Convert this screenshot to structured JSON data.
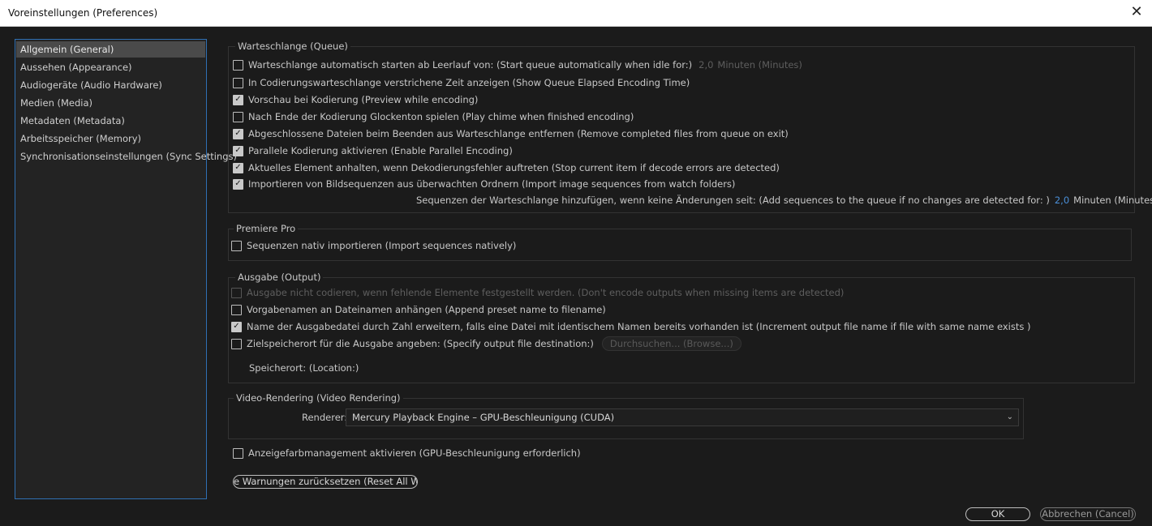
{
  "window": {
    "title": "Voreinstellungen (Preferences)",
    "close_glyph": "✕"
  },
  "sidebar": {
    "items": [
      {
        "label": "Allgemein (General)",
        "selected": true
      },
      {
        "label": "Aussehen (Appearance)"
      },
      {
        "label": "Audiogeräte (Audio Hardware)"
      },
      {
        "label": "Medien (Media)"
      },
      {
        "label": "Metadaten (Metadata)"
      },
      {
        "label": "Arbeitsspeicher (Memory)"
      },
      {
        "label": "Synchronisationseinstellungen (Sync Settings)"
      }
    ]
  },
  "queue": {
    "legend": "Warteschlange (Queue)",
    "items": [
      {
        "label": "Warteschlange automatisch starten ab Leerlauf von: (Start queue automatically when idle for:)",
        "checked": false,
        "value": "2,0",
        "unit": "Minuten (Minutes)"
      },
      {
        "label": "In Codierungswarteschlange verstrichene Zeit anzeigen (Show Queue Elapsed Encoding Time)",
        "checked": false
      },
      {
        "label": "Vorschau bei Kodierung (Preview while encoding)",
        "checked": true
      },
      {
        "label": "Nach Ende der Kodierung Glockenton spielen (Play chime when finished encoding)",
        "checked": false
      },
      {
        "label": "Abgeschlossene Dateien beim Beenden aus Warteschlange entfernen (Remove completed files from queue on exit)",
        "checked": true
      },
      {
        "label": "Parallele Kodierung aktivieren (Enable Parallel Encoding)",
        "checked": true
      },
      {
        "label": "Aktuelles Element anhalten, wenn Dekodierungsfehler auftreten (Stop current item if decode errors are detected)",
        "checked": true
      },
      {
        "label": "Importieren von Bildsequenzen aus überwachten Ordnern (Import image sequences from watch folders)",
        "checked": true
      }
    ],
    "add_seq_label": "Sequenzen der Warteschlange hinzufügen, wenn keine Änderungen seit:  (Add sequences to the queue if no changes are detected for: )",
    "add_seq_value": "2,0",
    "add_seq_unit": "Minuten (Minutes)"
  },
  "premiere": {
    "legend": "Premiere Pro",
    "items": [
      {
        "label": "Sequenzen nativ importieren (Import sequences natively)",
        "checked": false
      }
    ]
  },
  "output": {
    "legend": "Ausgabe (Output)",
    "items": [
      {
        "label": "Ausgabe nicht codieren, wenn fehlende Elemente festgestellt werden. (Don't encode outputs when missing items are detected)",
        "checked": false,
        "disabled": true
      },
      {
        "label": "Vorgabenamen an Dateinamen anhängen (Append preset name to filename)",
        "checked": false
      },
      {
        "label": "Name der Ausgabedatei durch Zahl erweitern, falls eine Datei mit identischem Namen bereits vorhanden ist  (Increment output file name if file with same name exists )",
        "checked": true
      },
      {
        "label": "Zielspeicherort für die Ausgabe angeben: (Specify output file destination:)",
        "checked": false
      }
    ],
    "browse_label": "Durchsuchen... (Browse...)",
    "location_label": "Speicherort: (Location:)"
  },
  "video": {
    "legend": "Video-Rendering (Video Rendering)",
    "renderer_label": "Renderer:",
    "renderer_value": "Mercury Playback Engine – GPU-Beschleunigung (CUDA)"
  },
  "display_color": {
    "label": "Anzeigefarbmanagement aktivieren (GPU-Beschleunigung erforderlich)",
    "checked": false
  },
  "reset_warnings_label": "e Warnungen zurücksetzen (Reset All Warning",
  "footer": {
    "ok_label": "OK",
    "cancel_label": "Abbrechen (Cancel)"
  },
  "colors": {
    "background": "#1b1b1b",
    "accent": "#2f6fb3",
    "value_blue": "#4a8fd8"
  },
  "icons": {
    "checkbox_checked": "check-icon",
    "select_arrow": "chevron-down-icon",
    "close": "close-icon"
  }
}
